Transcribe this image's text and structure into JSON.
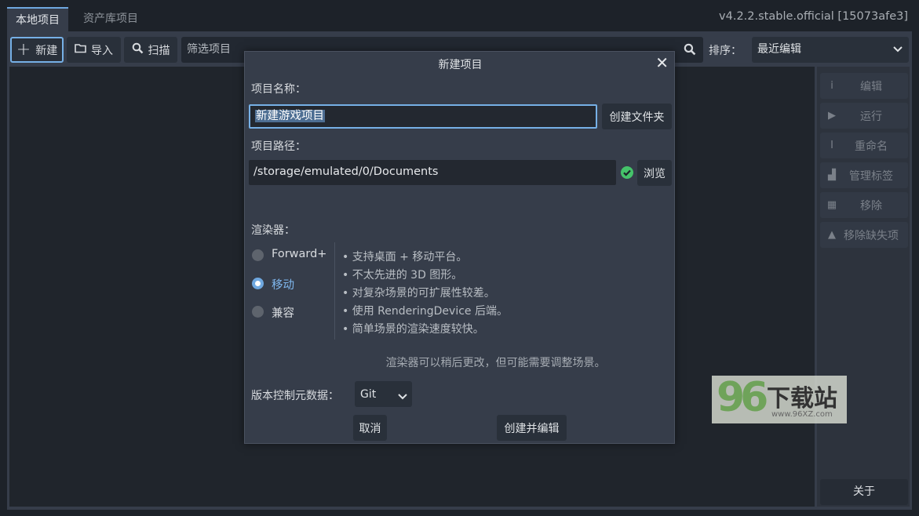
{
  "tabs": [
    {
      "label": "本地项目"
    },
    {
      "label": "资产库项目"
    }
  ],
  "version": "v4.2.2.stable.official [15073afe3]",
  "toolbar": {
    "new_label": "新建",
    "import_label": "导入",
    "scan_label": "扫描",
    "filter_placeholder": "筛选项目",
    "sort_label": "排序：",
    "sort_value": "最近编辑"
  },
  "sidebar": {
    "items": [
      {
        "label": "编辑",
        "icon": "info-icon"
      },
      {
        "label": "运行",
        "icon": "play-icon"
      },
      {
        "label": "重命名",
        "icon": "text-cursor-icon"
      },
      {
        "label": "管理标签",
        "icon": "tag-icon"
      },
      {
        "label": "移除",
        "icon": "trash-icon"
      },
      {
        "label": "移除缺失项",
        "icon": "broom-icon"
      }
    ],
    "about_label": "关于"
  },
  "dialog": {
    "title": "新建项目",
    "name_label": "项目名称：",
    "name_value": "新建游戏项目",
    "create_folder_label": "创建文件夹",
    "path_label": "项目路径：",
    "path_value": "/storage/emulated/0/Documents",
    "browse_label": "浏览",
    "renderer_label": "渲染器：",
    "renderers": [
      {
        "label": "Forward+",
        "selected": false
      },
      {
        "label": "移动",
        "selected": true
      },
      {
        "label": "兼容",
        "selected": false
      }
    ],
    "renderer_bullets": [
      "•  支持桌面 + 移动平台。",
      "•  不太先进的 3D 图形。",
      "•  对复杂场景的可扩展性较差。",
      "•  使用 RenderingDevice 后端。",
      "•  简单场景的渲染速度较快。"
    ],
    "renderer_note": "渲染器可以稍后更改，但可能需要调整场景。",
    "vcs_label": "版本控制元数据：",
    "vcs_value": "Git",
    "cancel_label": "取消",
    "create_label": "创建并编辑"
  },
  "watermark": {
    "number": "96",
    "text": "下载站",
    "url": "www.96XZ.com"
  },
  "colors": {
    "accent": "#6fa8e0",
    "panel": "#363d4a",
    "background": "#1d2229",
    "valid": "#45c36a"
  }
}
